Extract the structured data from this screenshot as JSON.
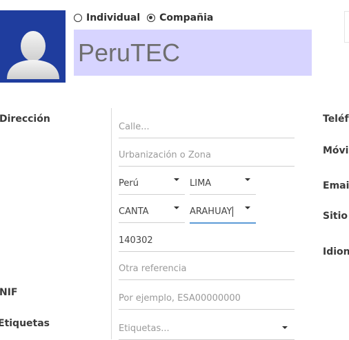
{
  "header": {
    "company_type": {
      "options": [
        {
          "label": "Individual",
          "checked": false
        },
        {
          "label": "Compañia",
          "checked": true
        }
      ]
    },
    "name_value": "PeruTEC",
    "avatar_icon": "user-silhouette-icon"
  },
  "address": {
    "label": "Dirección",
    "street_placeholder": "Calle...",
    "street2_placeholder": "Urbanización o Zona",
    "country_value": "Perú",
    "state_value": "LIMA",
    "province_value": "CANTA",
    "district_value": "ARAHUAY",
    "zip_value": "140302",
    "reference_placeholder": "Otra referencia"
  },
  "vat": {
    "label": "NIF",
    "placeholder": "Por ejemplo, ESA00000000"
  },
  "tags": {
    "label": "Etiquetas",
    "placeholder": "Etiquetas..."
  },
  "right_labels": {
    "phone": "Teléf",
    "mobile": "Móvil",
    "email": "Emai",
    "website": "Sitio w",
    "language": "Idion"
  }
}
